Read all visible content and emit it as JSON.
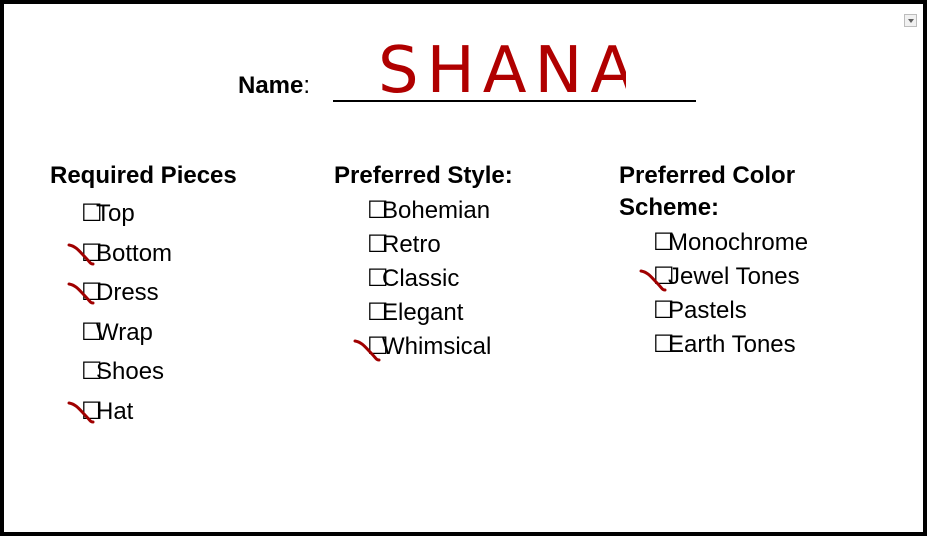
{
  "form": {
    "name_label": "Name",
    "name_colon": ":",
    "name_value": "SHANA"
  },
  "columns": [
    {
      "heading": "Required Pieces",
      "items": [
        {
          "label": "Top",
          "checked": false
        },
        {
          "label": "Bottom",
          "checked": true
        },
        {
          "label": "Dress",
          "checked": true
        },
        {
          "label": "Wrap",
          "checked": false
        },
        {
          "label": "Shoes",
          "checked": false
        },
        {
          "label": "Hat",
          "checked": true
        }
      ]
    },
    {
      "heading": "Preferred Style:",
      "items": [
        {
          "label": "Bohemian",
          "checked": false
        },
        {
          "label": "Retro",
          "checked": false
        },
        {
          "label": "Classic",
          "checked": false
        },
        {
          "label": "Elegant",
          "checked": false
        },
        {
          "label": "Whimsical",
          "checked": true
        }
      ]
    },
    {
      "heading": "Preferred Color Scheme:",
      "items": [
        {
          "label": "Monochrome",
          "checked": false
        },
        {
          "label": "Jewel Tones",
          "checked": true
        },
        {
          "label": "Pastels",
          "checked": false
        },
        {
          "label": "Earth Tones",
          "checked": false
        }
      ]
    }
  ],
  "checkbox_glyph": "☐",
  "colors": {
    "ink": "#a00000",
    "border": "#000000"
  }
}
